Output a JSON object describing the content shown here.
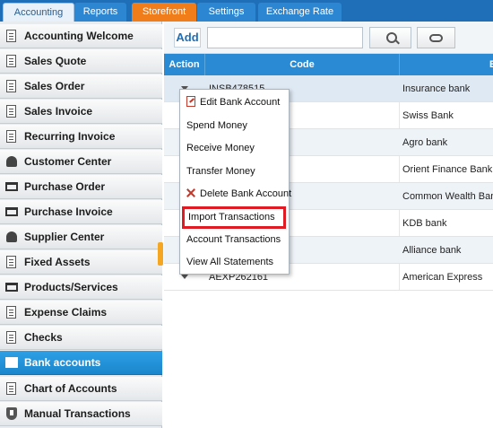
{
  "tabs": [
    {
      "label": "Accounting"
    },
    {
      "label": "Reports"
    },
    {
      "label": "Storefront"
    },
    {
      "label": "Settings"
    },
    {
      "label": "Exchange Rate"
    }
  ],
  "sidebar": {
    "items": [
      {
        "label": "Accounting Welcome",
        "icon": "document-icon"
      },
      {
        "label": "Sales Quote",
        "icon": "document-icon"
      },
      {
        "label": "Sales Order",
        "icon": "document-icon"
      },
      {
        "label": "Sales Invoice",
        "icon": "document-icon"
      },
      {
        "label": "Recurring Invoice",
        "icon": "document-icon"
      },
      {
        "label": "Customer Center",
        "icon": "people-icon"
      },
      {
        "label": "Purchase Order",
        "icon": "cart-icon"
      },
      {
        "label": "Purchase Invoice",
        "icon": "cart-icon"
      },
      {
        "label": "Supplier Center",
        "icon": "people-icon"
      },
      {
        "label": "Fixed Assets",
        "icon": "document-icon"
      },
      {
        "label": "Products/Services",
        "icon": "cart-icon"
      },
      {
        "label": "Expense Claims",
        "icon": "document-icon"
      },
      {
        "label": "Checks",
        "icon": "document-icon"
      },
      {
        "label": "Bank accounts",
        "icon": "bank-icon"
      },
      {
        "label": "Chart of Accounts",
        "icon": "document-icon"
      },
      {
        "label": "Manual Transactions",
        "icon": "shield-icon"
      }
    ]
  },
  "toolbar": {
    "add_label": "Add",
    "search_value": "",
    "search_placeholder": ""
  },
  "grid": {
    "headers": {
      "action": "Action",
      "code": "Code",
      "bank": "B"
    },
    "rows": [
      {
        "code": "INSB478515",
        "bank": "Insurance bank"
      },
      {
        "code": "",
        "bank": "Swiss Bank"
      },
      {
        "code": "",
        "bank": "Agro bank"
      },
      {
        "code": "",
        "bank": "Orient Finance Bank"
      },
      {
        "code": "",
        "bank": "Common Wealth Bank"
      },
      {
        "code": "",
        "bank": "KDB bank"
      },
      {
        "code": "",
        "bank": "Alliance bank"
      },
      {
        "code": "AEXP262161",
        "bank": "American Express"
      }
    ]
  },
  "context_menu": {
    "items": [
      {
        "label": "Edit Bank Account",
        "icon": "pencil-icon"
      },
      {
        "label": "Spend Money"
      },
      {
        "label": "Receive Money"
      },
      {
        "label": "Transfer Money"
      },
      {
        "label": "Delete Bank Account",
        "icon": "delete-icon"
      },
      {
        "label": "Import Transactions",
        "highlighted": true
      },
      {
        "label": "Account Transactions"
      },
      {
        "label": "View All Statements"
      }
    ]
  },
  "colors": {
    "accent": "#1f6fb8",
    "storefront_tab": "#f07c1a",
    "highlight_box": "#e01b24",
    "active_sidebar": "#1b86cc"
  }
}
